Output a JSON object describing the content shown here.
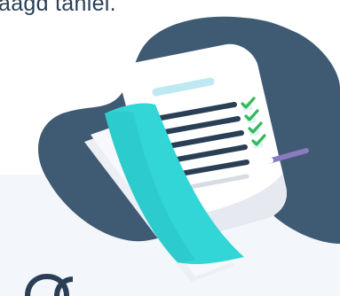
{
  "header": {
    "partial_text": "aagd taniel."
  },
  "illustration": {
    "name": "document-checklist-illustration",
    "checkmark_count": 4,
    "colors": {
      "blob": "#3f5a73",
      "paper": "#ffffff",
      "paper_shadow": "#e6e9ef",
      "accent_teal": "#33d6d6",
      "text_lines": "#2a3f55",
      "header_line": "#bfe9f2",
      "check": "#34b95a",
      "pen": "#8a7ac0"
    }
  },
  "background": {
    "panel_color": "#f3f6fb"
  }
}
